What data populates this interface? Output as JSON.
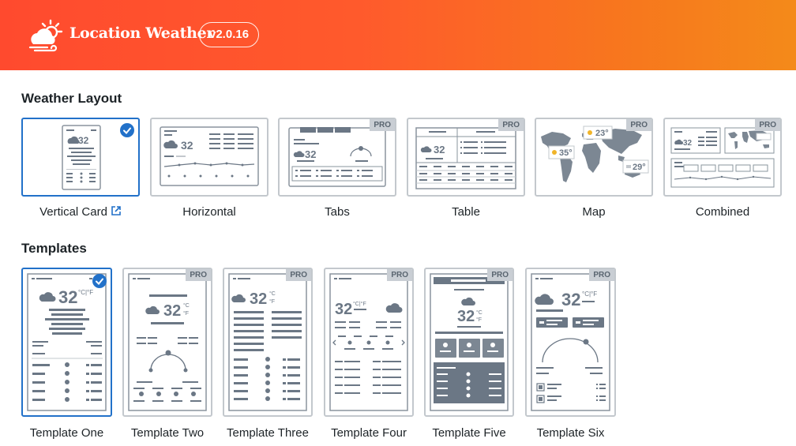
{
  "header": {
    "brand": "Location Weather",
    "version": "v2.0.16"
  },
  "weather_layout": {
    "title": "Weather Layout",
    "items": [
      {
        "label": "Vertical Card",
        "selected": true,
        "pro": false
      },
      {
        "label": "Horizontal",
        "selected": false,
        "pro": false
      },
      {
        "label": "Tabs",
        "selected": false,
        "pro": true
      },
      {
        "label": "Table",
        "selected": false,
        "pro": true
      },
      {
        "label": "Map",
        "selected": false,
        "pro": true
      },
      {
        "label": "Combined",
        "selected": false,
        "pro": true
      }
    ]
  },
  "templates": {
    "title": "Templates",
    "items": [
      {
        "label": "Template One",
        "selected": true,
        "pro": false
      },
      {
        "label": "Template Two",
        "selected": false,
        "pro": true
      },
      {
        "label": "Template Three",
        "selected": false,
        "pro": true
      },
      {
        "label": "Template Four",
        "selected": false,
        "pro": true
      },
      {
        "label": "Template Five",
        "selected": false,
        "pro": true
      },
      {
        "label": "Template Six",
        "selected": false,
        "pro": true
      }
    ]
  },
  "badges": {
    "pro": "PRO"
  },
  "preview_text": {
    "temp": "32",
    "unit_c": "°C",
    "unit_f": "°F",
    "unit_cf": "°C|°F",
    "map_temps": [
      "23°",
      "35°",
      "29°"
    ]
  },
  "colors": {
    "header_start": "#ff4a2e",
    "header_end": "#f48a1a",
    "selected": "#2271c9",
    "card_border": "#c3c8cd",
    "skeleton": "#6b7785"
  }
}
